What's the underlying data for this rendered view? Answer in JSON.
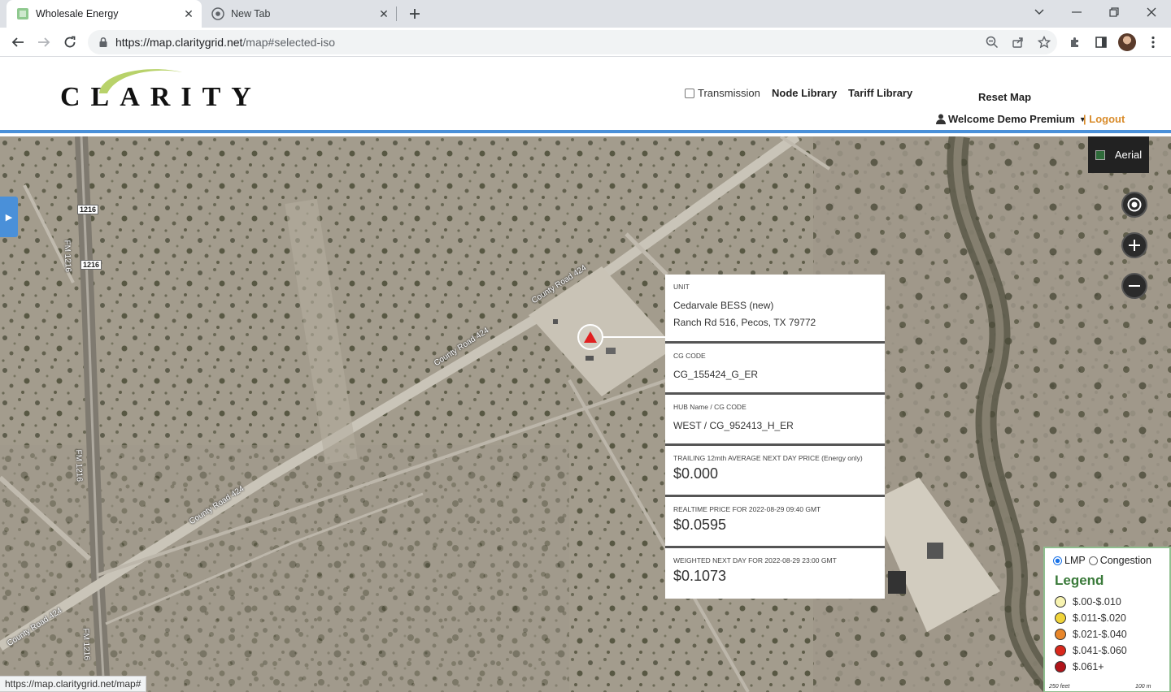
{
  "browser": {
    "tabs": [
      {
        "title": "Wholesale Energy",
        "active": true
      },
      {
        "title": "New Tab",
        "active": false
      }
    ],
    "url_host": "https://map.claritygrid.net",
    "url_path": "/map#selected-iso",
    "status_url": "https://map.claritygrid.net/map#"
  },
  "header": {
    "logo_text": "CLARITY",
    "transmission_label": "Transmission",
    "node_library": "Node Library",
    "tariff_library": "Tariff Library",
    "reset_map": "Reset Map",
    "welcome": "Welcome Demo Premium",
    "logout": "| Logout"
  },
  "map": {
    "aerial_label": "Aerial",
    "road_labels": {
      "county_road_1": "County Road 424",
      "county_road_2": "County Road 424",
      "county_road_3": "County Road 424",
      "county_road_4": "County Road 424",
      "fm_1": "FM 1216",
      "fm_2": "FM 1216",
      "fm_3": "FM 1216",
      "shield_1": "1216",
      "shield_2": "1216"
    }
  },
  "info": {
    "unit_label": "UNIT",
    "unit_name": "Cedarvale BESS (new)",
    "unit_address": "Ranch Rd 516, Pecos, TX 79772",
    "cg_code_label": "CG CODE",
    "cg_code": "CG_155424_G_ER",
    "hub_label": "HUB Name / CG CODE",
    "hub_value": "WEST / CG_952413_H_ER",
    "trailing_label": "TRAILING 12mth AVERAGE NEXT DAY PRICE (Energy only)",
    "trailing_value": "$0.000",
    "realtime_label": "REALTIME PRICE FOR 2022-08-29 09:40 GMT",
    "realtime_value": "$0.0595",
    "weighted_label": "WEIGHTED NEXT DAY FOR 2022-08-29 23:00 GMT",
    "weighted_value": "$0.1073"
  },
  "legend": {
    "radio_lmp": "LMP",
    "radio_congestion": "Congestion",
    "title": "Legend",
    "items": [
      {
        "label": "$.00-$.010",
        "color": "#f7f3b0"
      },
      {
        "label": "$.011-$.020",
        "color": "#f0d43a"
      },
      {
        "label": "$.021-$.040",
        "color": "#e8862a"
      },
      {
        "label": "$.041-$.060",
        "color": "#d9281c"
      },
      {
        "label": "$.061+",
        "color": "#b0141a"
      }
    ],
    "scale_feet": "250 feet",
    "scale_m": "100 m"
  }
}
